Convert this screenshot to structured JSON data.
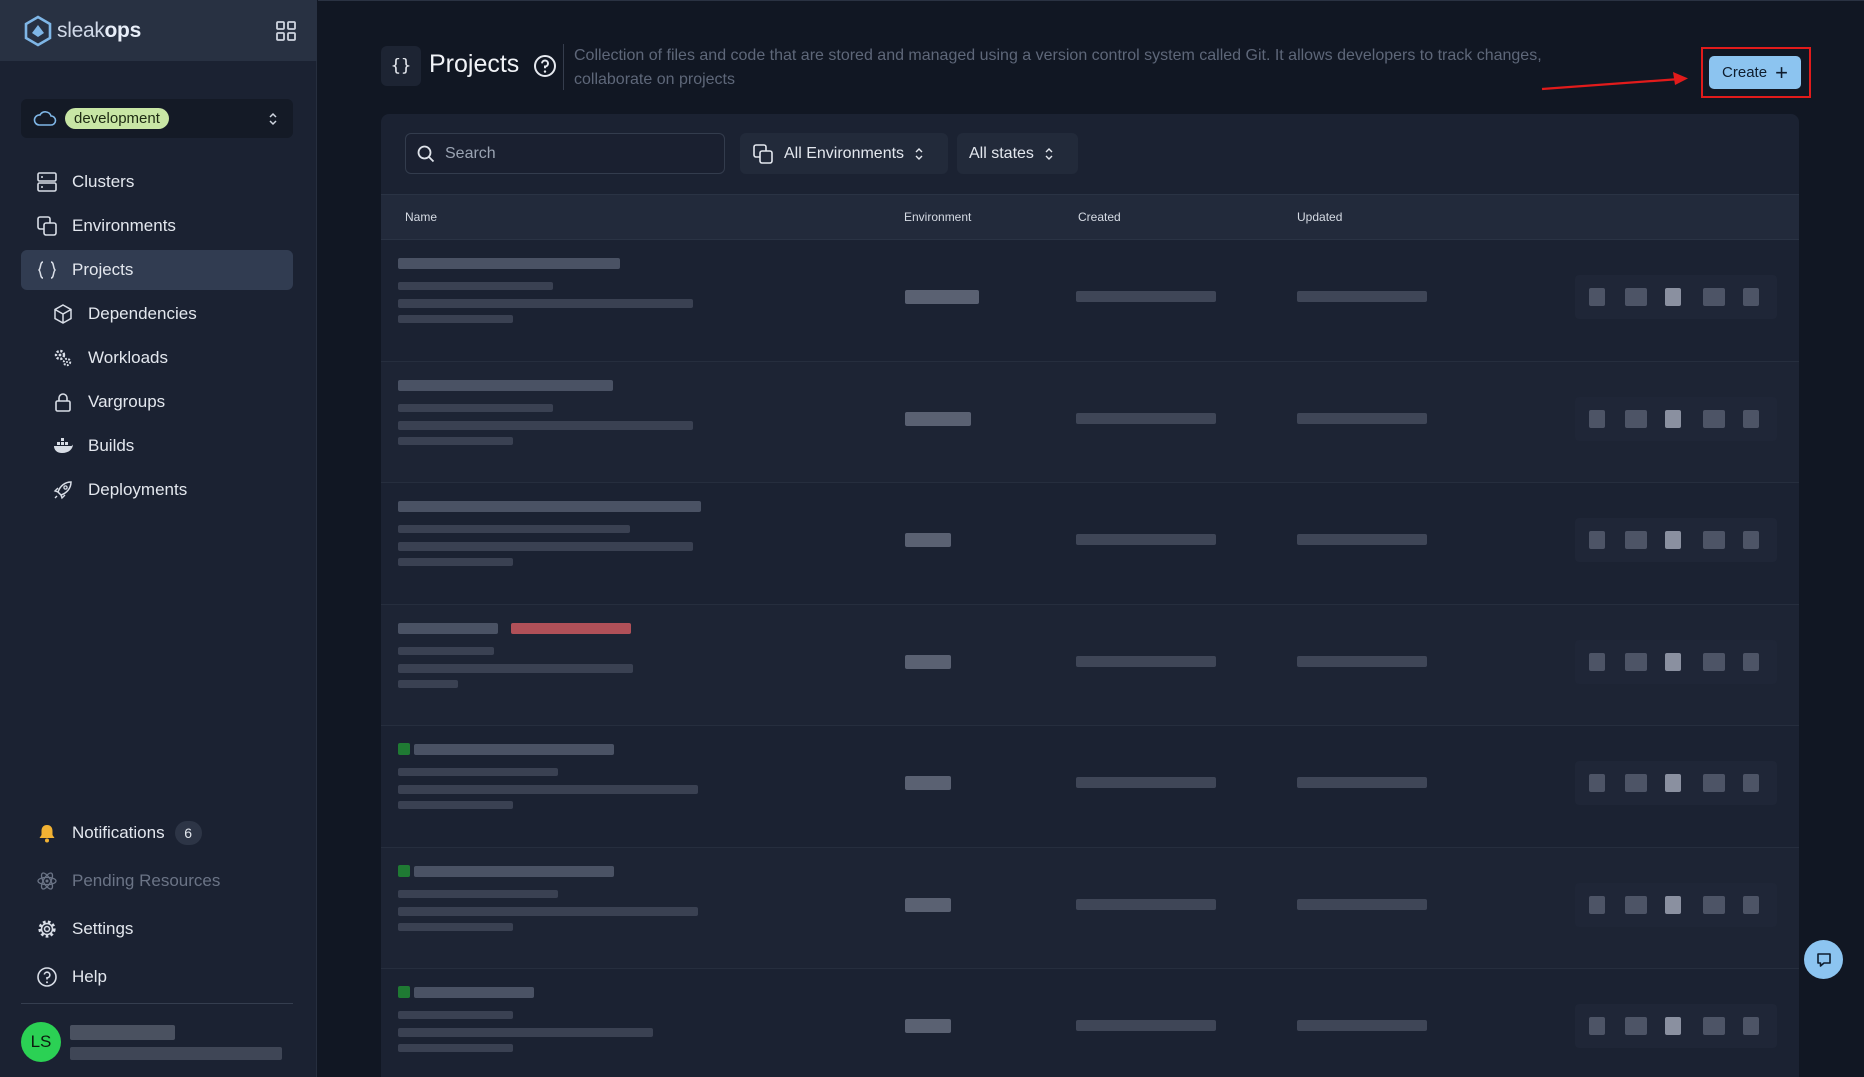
{
  "brand": {
    "name_part1": "sleak",
    "name_part2": "ops"
  },
  "environment": {
    "selected": "development"
  },
  "sidebar": {
    "items": [
      {
        "label": "Clusters",
        "icon": "server-icon"
      },
      {
        "label": "Environments",
        "icon": "copy-icon"
      },
      {
        "label": "Projects",
        "icon": "braces-icon",
        "active": true
      },
      {
        "label": "Dependencies",
        "icon": "cube-icon"
      },
      {
        "label": "Workloads",
        "icon": "cogs-icon"
      },
      {
        "label": "Vargroups",
        "icon": "lock-icon"
      },
      {
        "label": "Builds",
        "icon": "docker-icon"
      },
      {
        "label": "Deployments",
        "icon": "rocket-icon"
      }
    ],
    "bottom": [
      {
        "label": "Notifications",
        "icon": "bell-icon",
        "count": "6"
      },
      {
        "label": "Pending Resources",
        "icon": "atom-icon"
      },
      {
        "label": "Settings",
        "icon": "gear-icon"
      },
      {
        "label": "Help",
        "icon": "help-circle-icon"
      }
    ]
  },
  "user": {
    "initials": "LS"
  },
  "page": {
    "title": "Projects",
    "braces": "{}",
    "description": "Collection of files and code that are stored and managed using a version control system called Git. It allows developers to track changes, collaborate on projects",
    "create_label": "Create"
  },
  "filters": {
    "search_placeholder": "Search",
    "environments_label": "All Environments",
    "states_label": "All states"
  },
  "table": {
    "columns": [
      "Name",
      "Environment",
      "Created",
      "Updated"
    ],
    "row_count": 7
  },
  "colors": {
    "accent": "#8cc4f0",
    "active_nav": "#313c51",
    "highlight": "#e21b1b",
    "avatar": "#2bd154",
    "env_badge": "#c8e6a5"
  }
}
